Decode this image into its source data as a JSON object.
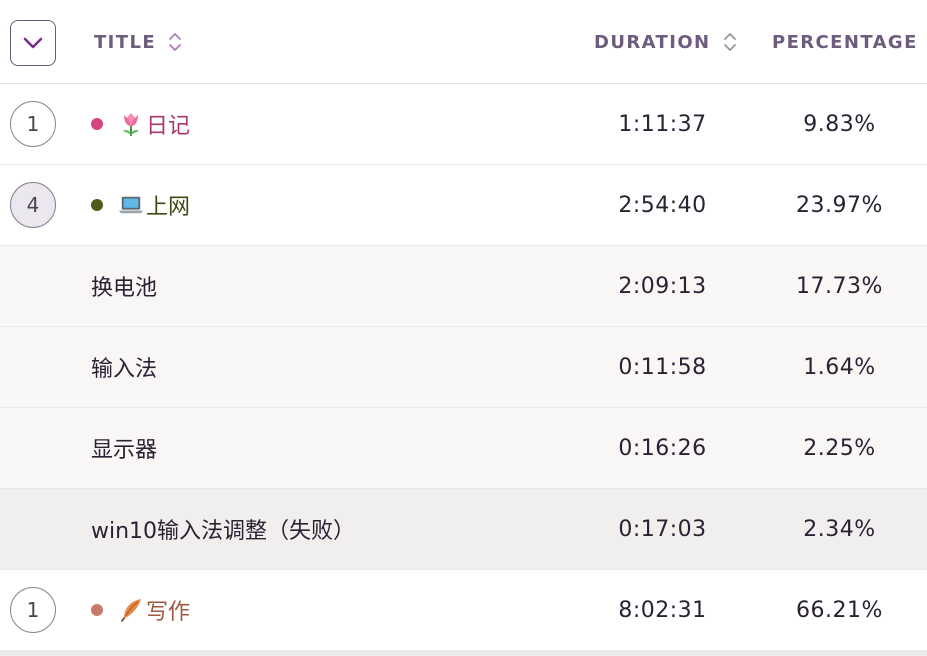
{
  "header": {
    "toggle_icon": "chevron-down-icon",
    "title_label": "TITLE",
    "duration_label": "DURATION",
    "percentage_label": "PERCENTAGE",
    "sort_icon": "sort-icon",
    "accent_color": "#7a2f8e"
  },
  "rows": [
    {
      "type": "category",
      "count": "1",
      "dot_color": "#d6457f",
      "emoji": "tulip-icon",
      "label": "日记",
      "label_color": "#a83670",
      "duration": "1:11:37",
      "percentage": "9.83%"
    },
    {
      "type": "category",
      "count": "4",
      "expanded": true,
      "dot_color": "#4f5a1c",
      "emoji": "laptop-icon",
      "label": "上网",
      "label_color": "#3e4a12",
      "duration": "2:54:40",
      "percentage": "23.97%"
    },
    {
      "type": "sub",
      "label": "换电池",
      "duration": "2:09:13",
      "percentage": "17.73%"
    },
    {
      "type": "sub",
      "label": "输入法",
      "duration": "0:11:58",
      "percentage": "1.64%"
    },
    {
      "type": "sub",
      "label": "显示器",
      "duration": "0:16:26",
      "percentage": "2.25%"
    },
    {
      "type": "sub",
      "label": "win10输入法调整（失败）",
      "duration": "0:17:03",
      "percentage": "2.34%"
    },
    {
      "type": "category",
      "count": "1",
      "dot_color": "#c87a6a",
      "emoji": "feather-icon",
      "label": "写作",
      "label_color": "#9c5a3e",
      "duration": "8:02:31",
      "percentage": "66.21%"
    }
  ]
}
